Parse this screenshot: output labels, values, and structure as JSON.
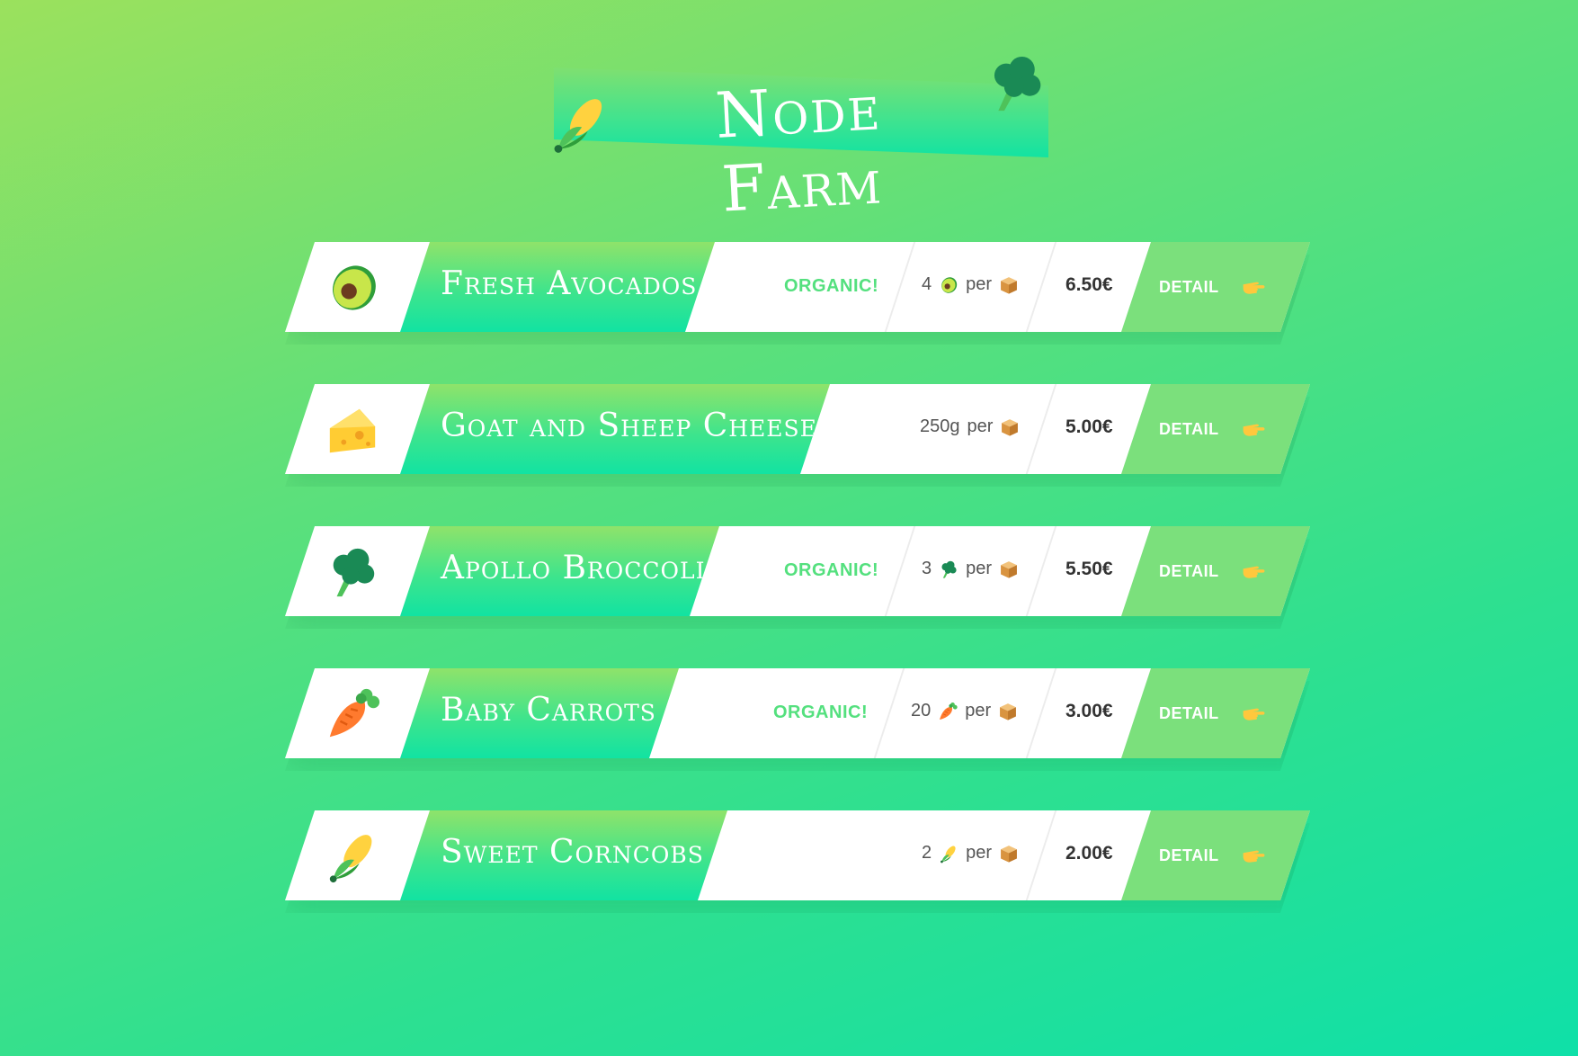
{
  "header": {
    "title": "Node Farm"
  },
  "products": [
    {
      "name": "Fresh Avocados",
      "organic": "ORGANIC!",
      "qty": "4",
      "per": "per",
      "price": "6.50€",
      "detail": "DETAIL",
      "icon": "avocado-icon"
    },
    {
      "name": "Goat and Sheep Cheese",
      "organic": "",
      "qty": "250g",
      "per": "per",
      "price": "5.00€",
      "detail": "DETAIL",
      "icon": "cheese-icon"
    },
    {
      "name": "Apollo Broccoli",
      "organic": "ORGANIC!",
      "qty": "3",
      "per": "per",
      "price": "5.50€",
      "detail": "DETAIL",
      "icon": "broccoli-icon"
    },
    {
      "name": "Baby Carrots",
      "organic": "ORGANIC!",
      "qty": "20",
      "per": "per",
      "price": "3.00€",
      "detail": "DETAIL",
      "icon": "carrot-icon"
    },
    {
      "name": "Sweet Corncobs",
      "organic": "",
      "qty": "2",
      "per": "per",
      "price": "2.00€",
      "detail": "DETAIL",
      "icon": "corn-icon"
    }
  ],
  "colors": {
    "accent": "#54e07e",
    "detail_band": "#7be07c"
  }
}
